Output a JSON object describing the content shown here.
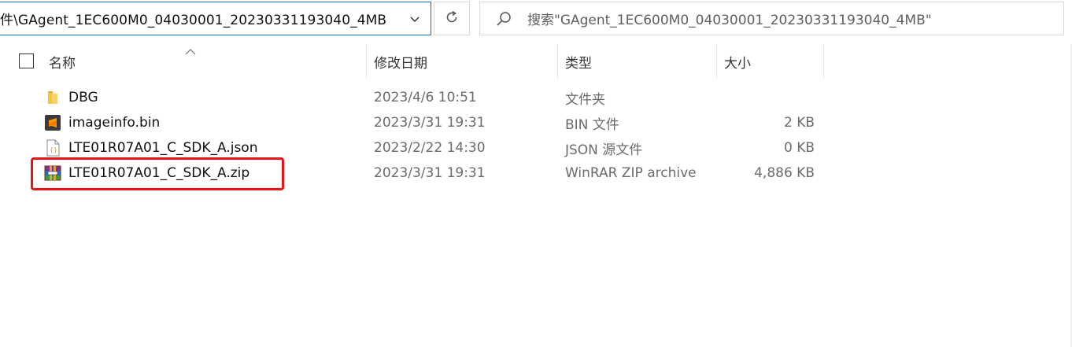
{
  "address_bar": {
    "path_text": "件\\GAgent_1EC600M0_04030001_20230331193040_4MB",
    "chevron_icon": "chevron-down-icon"
  },
  "toolbar": {
    "refresh_icon": "refresh-icon"
  },
  "search": {
    "placeholder": "搜索\"GAgent_1EC600M0_04030001_20230331193040_4MB\"",
    "icon": "search-icon"
  },
  "columns": {
    "name": "名称",
    "modified": "修改日期",
    "type": "类型",
    "size": "大小"
  },
  "files": [
    {
      "name": "DBG",
      "modified": "2023/4/6 10:51",
      "type": "文件夹",
      "size": "",
      "icon": "folder-icon"
    },
    {
      "name": "imageinfo.bin",
      "modified": "2023/3/31 19:31",
      "type": "BIN 文件",
      "size": "2 KB",
      "icon": "sublime-file-icon"
    },
    {
      "name": "LTE01R07A01_C_SDK_A.json",
      "modified": "2023/2/22 14:30",
      "type": "JSON 源文件",
      "size": "0 KB",
      "icon": "json-file-icon"
    },
    {
      "name": "LTE01R07A01_C_SDK_A.zip",
      "modified": "2023/3/31 19:31",
      "type": "WinRAR ZIP archive",
      "size": "4,886 KB",
      "icon": "winrar-archive-icon"
    }
  ],
  "colors": {
    "accent_border": "#0a6ebd",
    "highlight": "#e8141a",
    "folder": "#f2c14e"
  }
}
